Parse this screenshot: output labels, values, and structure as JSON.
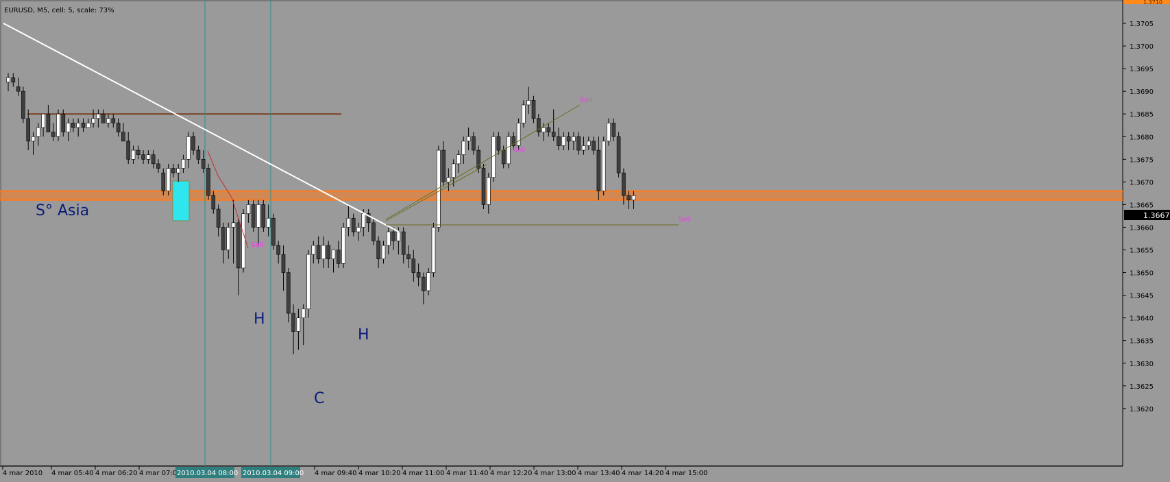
{
  "header": {
    "title": "EURUSD, M5, cell: 5, scale: 73%"
  },
  "colors": {
    "background": "#9a9a9a",
    "axis_bg": "#9a9a9a",
    "bull": "#ffffff",
    "bear": "#3f3f3f",
    "wick": "#000000",
    "trendline": "#ffffff",
    "resistance": "#7a3f20",
    "support_band": "#ff7a1a",
    "vline": "#2a8f8f",
    "box": "#2fe6ee",
    "pattern_text": "#0a1a7a",
    "sell_signal": "#ff2fff",
    "price_tag_bg": "#000000",
    "time_tag_bg": "#2f7f7f",
    "zigzag": "#c03030",
    "channel": "#6a6a20"
  },
  "annotations": {
    "session_label": "S° Asia",
    "left_shoulder": "H",
    "right_shoulder": "H",
    "head": "C",
    "signal_label": "Sell"
  },
  "price_axis": {
    "labels": [
      "1.3705",
      "1.3700",
      "1.3695",
      "1.3690",
      "1.3685",
      "1.3680",
      "1.3675",
      "1.3670",
      "1.3665",
      "1.3660",
      "1.3655",
      "1.3650",
      "1.3645",
      "1.3640",
      "1.3635",
      "1.3630",
      "1.3625",
      "1.3620"
    ],
    "current_price": "1.3667",
    "top_cut_label": "1.3710"
  },
  "time_axis": {
    "labels": [
      "4 mar 2010",
      "4 mar 05:40",
      "4 mar 06:20",
      "4 mar 07:00",
      "4 mar 09:40",
      "4 mar 10:20",
      "4 mar 11:00",
      "4 mar 11:40",
      "4 mar 12:20",
      "4 mar 13:00",
      "4 mar 13:40",
      "4 mar 14:20",
      "4 mar 15:00"
    ],
    "highlighted": [
      "2010.03.04 08:00",
      "2010.03.04 09:00"
    ]
  },
  "chart_data": {
    "type": "candlestick",
    "symbol": "EURUSD",
    "timeframe": "M5",
    "ylim": [
      1.3615,
      1.3712
    ],
    "candles": [
      [
        1.3692,
        1.3694,
        1.369,
        1.3693
      ],
      [
        1.3693,
        1.3694,
        1.3691,
        1.3692
      ],
      [
        1.3691,
        1.3693,
        1.3689,
        1.369
      ],
      [
        1.369,
        1.3691,
        1.3683,
        1.3684
      ],
      [
        1.3684,
        1.3686,
        1.3677,
        1.3679
      ],
      [
        1.3679,
        1.3681,
        1.3676,
        1.368
      ],
      [
        1.368,
        1.3683,
        1.3678,
        1.3682
      ],
      [
        1.3682,
        1.3684,
        1.368,
        1.3685
      ],
      [
        1.3685,
        1.3687,
        1.3681,
        1.3681
      ],
      [
        1.3681,
        1.3683,
        1.3679,
        1.368
      ],
      [
        1.368,
        1.3686,
        1.3679,
        1.3685
      ],
      [
        1.3685,
        1.3686,
        1.368,
        1.3681
      ],
      [
        1.3681,
        1.3684,
        1.3679,
        1.3683
      ],
      [
        1.3683,
        1.3684,
        1.3681,
        1.3682
      ],
      [
        1.3682,
        1.3684,
        1.368,
        1.3683
      ],
      [
        1.3683,
        1.3684,
        1.3681,
        1.3682
      ],
      [
        1.3682,
        1.3684,
        1.3682,
        1.3683
      ],
      [
        1.3683,
        1.3686,
        1.3682,
        1.3684
      ],
      [
        1.3684,
        1.3686,
        1.3682,
        1.3685
      ],
      [
        1.3685,
        1.3686,
        1.3683,
        1.3683
      ],
      [
        1.3683,
        1.3685,
        1.3682,
        1.3684
      ],
      [
        1.3684,
        1.3685,
        1.3682,
        1.3683
      ],
      [
        1.3683,
        1.3684,
        1.368,
        1.3681
      ],
      [
        1.3681,
        1.3683,
        1.3679,
        1.3679
      ],
      [
        1.3679,
        1.3681,
        1.3674,
        1.3675
      ],
      [
        1.3675,
        1.3678,
        1.3674,
        1.3677
      ],
      [
        1.3677,
        1.3678,
        1.3675,
        1.3676
      ],
      [
        1.3676,
        1.3677,
        1.3674,
        1.3675
      ],
      [
        1.3675,
        1.3677,
        1.3674,
        1.3676
      ],
      [
        1.3676,
        1.3677,
        1.3673,
        1.3674
      ],
      [
        1.3674,
        1.3675,
        1.3672,
        1.3673
      ],
      [
        1.3672,
        1.3673,
        1.3667,
        1.3668
      ],
      [
        1.3668,
        1.3674,
        1.3667,
        1.3673
      ],
      [
        1.3673,
        1.3674,
        1.3671,
        1.3672
      ],
      [
        1.3672,
        1.3674,
        1.367,
        1.3673
      ],
      [
        1.3673,
        1.3676,
        1.3672,
        1.3675
      ],
      [
        1.3675,
        1.3681,
        1.3673,
        1.368
      ],
      [
        1.368,
        1.3681,
        1.3676,
        1.3677
      ],
      [
        1.3677,
        1.3678,
        1.3674,
        1.3675
      ],
      [
        1.3675,
        1.3677,
        1.3672,
        1.3673
      ],
      [
        1.3673,
        1.3674,
        1.3666,
        1.3667
      ],
      [
        1.3667,
        1.3668,
        1.3663,
        1.3664
      ],
      [
        1.3664,
        1.3665,
        1.3658,
        1.366
      ],
      [
        1.366,
        1.3661,
        1.3652,
        1.3655
      ],
      [
        1.3655,
        1.3661,
        1.3653,
        1.366
      ],
      [
        1.366,
        1.3666,
        1.3652,
        1.3661
      ],
      [
        1.3661,
        1.3662,
        1.3645,
        1.3651
      ],
      [
        1.3651,
        1.3664,
        1.365,
        1.3663
      ],
      [
        1.3663,
        1.3666,
        1.3661,
        1.3665
      ],
      [
        1.3665,
        1.3666,
        1.3659,
        1.366
      ],
      [
        1.366,
        1.3666,
        1.3656,
        1.3665
      ],
      [
        1.3665,
        1.3666,
        1.3659,
        1.366
      ],
      [
        1.366,
        1.3665,
        1.3658,
        1.3662
      ],
      [
        1.3662,
        1.3663,
        1.3655,
        1.3656
      ],
      [
        1.3656,
        1.3657,
        1.3652,
        1.3654
      ],
      [
        1.3654,
        1.3656,
        1.3646,
        1.365
      ],
      [
        1.365,
        1.3651,
        1.3639,
        1.3641
      ],
      [
        1.3641,
        1.3643,
        1.3632,
        1.3637
      ],
      [
        1.3637,
        1.3642,
        1.3633,
        1.364
      ],
      [
        1.364,
        1.3643,
        1.3634,
        1.3642
      ],
      [
        1.3642,
        1.3655,
        1.364,
        1.3654
      ],
      [
        1.3654,
        1.3657,
        1.3652,
        1.3656
      ],
      [
        1.3656,
        1.3658,
        1.3652,
        1.3653
      ],
      [
        1.3653,
        1.3658,
        1.3651,
        1.3656
      ],
      [
        1.3656,
        1.3657,
        1.3651,
        1.3653
      ],
      [
        1.3653,
        1.3655,
        1.365,
        1.3655
      ],
      [
        1.3655,
        1.3657,
        1.3651,
        1.3652
      ],
      [
        1.3652,
        1.3661,
        1.3651,
        1.366
      ],
      [
        1.366,
        1.3665,
        1.3658,
        1.3662
      ],
      [
        1.3662,
        1.3663,
        1.3658,
        1.3659
      ],
      [
        1.3659,
        1.3661,
        1.3657,
        1.366
      ],
      [
        1.366,
        1.3664,
        1.3658,
        1.3663
      ],
      [
        1.3663,
        1.3664,
        1.3659,
        1.3661
      ],
      [
        1.3661,
        1.3662,
        1.3656,
        1.3657
      ],
      [
        1.3657,
        1.3658,
        1.3651,
        1.3653
      ],
      [
        1.3653,
        1.3657,
        1.3652,
        1.3656
      ],
      [
        1.3656,
        1.366,
        1.3654,
        1.3659
      ],
      [
        1.3659,
        1.366,
        1.3655,
        1.3657
      ],
      [
        1.3657,
        1.366,
        1.3654,
        1.3659
      ],
      [
        1.3659,
        1.366,
        1.3652,
        1.3654
      ],
      [
        1.3654,
        1.3656,
        1.3651,
        1.3653
      ],
      [
        1.3653,
        1.3655,
        1.3648,
        1.365
      ],
      [
        1.365,
        1.3652,
        1.3647,
        1.3649
      ],
      [
        1.3649,
        1.365,
        1.3643,
        1.3646
      ],
      [
        1.3646,
        1.3651,
        1.3645,
        1.365
      ],
      [
        1.365,
        1.3661,
        1.3649,
        1.366
      ],
      [
        1.366,
        1.3678,
        1.3659,
        1.3677
      ],
      [
        1.3677,
        1.3679,
        1.3669,
        1.367
      ],
      [
        1.367,
        1.3673,
        1.3668,
        1.3671
      ],
      [
        1.3671,
        1.3675,
        1.3669,
        1.3674
      ],
      [
        1.3674,
        1.3677,
        1.3672,
        1.3676
      ],
      [
        1.3676,
        1.368,
        1.3674,
        1.3679
      ],
      [
        1.3679,
        1.3682,
        1.3677,
        1.368
      ],
      [
        1.368,
        1.3681,
        1.3676,
        1.3677
      ],
      [
        1.3677,
        1.3678,
        1.3672,
        1.3673
      ],
      [
        1.3673,
        1.3674,
        1.3664,
        1.3665
      ],
      [
        1.3665,
        1.3672,
        1.3663,
        1.3671
      ],
      [
        1.3671,
        1.3681,
        1.367,
        1.368
      ],
      [
        1.368,
        1.3681,
        1.3676,
        1.3677
      ],
      [
        1.3677,
        1.3678,
        1.3673,
        1.3674
      ],
      [
        1.3674,
        1.3681,
        1.3673,
        1.368
      ],
      [
        1.368,
        1.3681,
        1.3677,
        1.3678
      ],
      [
        1.3678,
        1.3684,
        1.3677,
        1.3683
      ],
      [
        1.3683,
        1.3688,
        1.3682,
        1.3687
      ],
      [
        1.3687,
        1.3691,
        1.3685,
        1.3688
      ],
      [
        1.3688,
        1.3689,
        1.3683,
        1.3684
      ],
      [
        1.3684,
        1.3685,
        1.368,
        1.3681
      ],
      [
        1.3681,
        1.3683,
        1.3679,
        1.3682
      ],
      [
        1.3682,
        1.3683,
        1.368,
        1.3681
      ],
      [
        1.3681,
        1.3686,
        1.3679,
        1.368
      ],
      [
        1.368,
        1.3682,
        1.3677,
        1.3678
      ],
      [
        1.3678,
        1.3681,
        1.3677,
        1.368
      ],
      [
        1.368,
        1.3681,
        1.3677,
        1.3679
      ],
      [
        1.3679,
        1.3681,
        1.3677,
        1.368
      ],
      [
        1.368,
        1.3681,
        1.3676,
        1.3677
      ],
      [
        1.3677,
        1.368,
        1.3676,
        1.3678
      ],
      [
        1.3678,
        1.368,
        1.3677,
        1.3679
      ],
      [
        1.3679,
        1.368,
        1.3676,
        1.3677
      ],
      [
        1.3677,
        1.368,
        1.3666,
        1.3668
      ],
      [
        1.3668,
        1.368,
        1.3667,
        1.3679
      ],
      [
        1.3679,
        1.3684,
        1.3678,
        1.3683
      ],
      [
        1.3683,
        1.3684,
        1.3679,
        1.368
      ],
      [
        1.368,
        1.3681,
        1.3671,
        1.3672
      ],
      [
        1.3672,
        1.3673,
        1.3665,
        1.3667
      ],
      [
        1.3667,
        1.3668,
        1.3664,
        1.3666
      ],
      [
        1.3666,
        1.3668,
        1.3664,
        1.3667
      ]
    ],
    "horizontal_levels": [
      {
        "kind": "resistance",
        "price": 1.3685
      },
      {
        "kind": "support_band_top",
        "price": 1.3668
      },
      {
        "kind": "support_band_bottom",
        "price": 1.3666
      }
    ],
    "trendline": {
      "from_price": 1.3705,
      "to_price": 1.3659
    },
    "sell_signals": [
      "1.3661",
      "1.3680",
      "1.3689",
      "1.3666"
    ]
  }
}
